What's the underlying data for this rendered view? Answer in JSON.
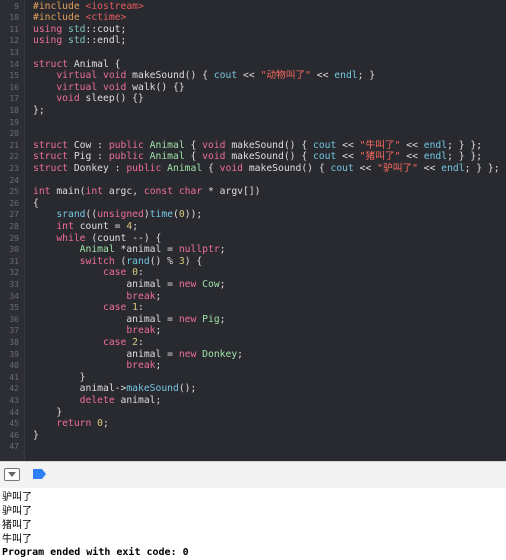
{
  "editor": {
    "lines": [
      {
        "n": "9",
        "tokens": [
          {
            "t": "#include ",
            "c": "pp"
          },
          {
            "t": "<iostream>",
            "c": "inc"
          }
        ]
      },
      {
        "n": "10",
        "tokens": [
          {
            "t": "#include ",
            "c": "pp"
          },
          {
            "t": "<ctime>",
            "c": "inc"
          }
        ]
      },
      {
        "n": "11",
        "tokens": [
          {
            "t": "using ",
            "c": "kw"
          },
          {
            "t": "std",
            "c": "ty"
          },
          {
            "t": "::cout;",
            "c": ""
          }
        ]
      },
      {
        "n": "12",
        "tokens": [
          {
            "t": "using ",
            "c": "kw"
          },
          {
            "t": "std",
            "c": "ty"
          },
          {
            "t": "::endl;",
            "c": ""
          }
        ]
      },
      {
        "n": "13",
        "tokens": []
      },
      {
        "n": "14",
        "tokens": [
          {
            "t": "struct ",
            "c": "kw"
          },
          {
            "t": "Animal {",
            "c": ""
          }
        ]
      },
      {
        "n": "15",
        "tokens": [
          {
            "t": "    ",
            "c": ""
          },
          {
            "t": "virtual void ",
            "c": "kw"
          },
          {
            "t": "makeSound() { ",
            "c": ""
          },
          {
            "t": "cout",
            "c": "fn"
          },
          {
            "t": " << ",
            "c": ""
          },
          {
            "t": "\"动物叫了\"",
            "c": "str"
          },
          {
            "t": " << ",
            "c": ""
          },
          {
            "t": "endl",
            "c": "fn"
          },
          {
            "t": "; }",
            "c": ""
          }
        ]
      },
      {
        "n": "16",
        "tokens": [
          {
            "t": "    ",
            "c": ""
          },
          {
            "t": "virtual void ",
            "c": "kw"
          },
          {
            "t": "walk() {}",
            "c": ""
          }
        ]
      },
      {
        "n": "17",
        "tokens": [
          {
            "t": "    ",
            "c": ""
          },
          {
            "t": "void ",
            "c": "kw"
          },
          {
            "t": "sleep() {}",
            "c": ""
          }
        ]
      },
      {
        "n": "18",
        "tokens": [
          {
            "t": "};",
            "c": ""
          }
        ]
      },
      {
        "n": "19",
        "tokens": []
      },
      {
        "n": "20",
        "tokens": []
      },
      {
        "n": "21",
        "tokens": [
          {
            "t": "struct ",
            "c": "kw"
          },
          {
            "t": "Cow : ",
            "c": ""
          },
          {
            "t": "public ",
            "c": "kw"
          },
          {
            "t": "Animal",
            "c": "cls"
          },
          {
            "t": " { ",
            "c": ""
          },
          {
            "t": "void ",
            "c": "kw"
          },
          {
            "t": "makeSound() { ",
            "c": ""
          },
          {
            "t": "cout",
            "c": "fn"
          },
          {
            "t": " << ",
            "c": ""
          },
          {
            "t": "\"牛叫了\"",
            "c": "str"
          },
          {
            "t": " << ",
            "c": ""
          },
          {
            "t": "endl",
            "c": "fn"
          },
          {
            "t": "; } };",
            "c": ""
          }
        ]
      },
      {
        "n": "22",
        "tokens": [
          {
            "t": "struct ",
            "c": "kw"
          },
          {
            "t": "Pig : ",
            "c": ""
          },
          {
            "t": "public ",
            "c": "kw"
          },
          {
            "t": "Animal",
            "c": "cls"
          },
          {
            "t": " { ",
            "c": ""
          },
          {
            "t": "void ",
            "c": "kw"
          },
          {
            "t": "makeSound() { ",
            "c": ""
          },
          {
            "t": "cout",
            "c": "fn"
          },
          {
            "t": " << ",
            "c": ""
          },
          {
            "t": "\"猪叫了\"",
            "c": "str"
          },
          {
            "t": " << ",
            "c": ""
          },
          {
            "t": "endl",
            "c": "fn"
          },
          {
            "t": "; } };",
            "c": ""
          }
        ]
      },
      {
        "n": "23",
        "tokens": [
          {
            "t": "struct ",
            "c": "kw"
          },
          {
            "t": "Donkey : ",
            "c": ""
          },
          {
            "t": "public ",
            "c": "kw"
          },
          {
            "t": "Animal",
            "c": "cls"
          },
          {
            "t": " { ",
            "c": ""
          },
          {
            "t": "void ",
            "c": "kw"
          },
          {
            "t": "makeSound() { ",
            "c": ""
          },
          {
            "t": "cout",
            "c": "fn"
          },
          {
            "t": " << ",
            "c": ""
          },
          {
            "t": "\"驴叫了\"",
            "c": "str"
          },
          {
            "t": " << ",
            "c": ""
          },
          {
            "t": "endl",
            "c": "fn"
          },
          {
            "t": "; } };",
            "c": ""
          }
        ]
      },
      {
        "n": "24",
        "tokens": []
      },
      {
        "n": "25",
        "tokens": [
          {
            "t": "int ",
            "c": "kw"
          },
          {
            "t": "main(",
            "c": ""
          },
          {
            "t": "int ",
            "c": "kw"
          },
          {
            "t": "argc, ",
            "c": ""
          },
          {
            "t": "const char ",
            "c": "kw"
          },
          {
            "t": "* argv[])",
            "c": ""
          }
        ]
      },
      {
        "n": "26",
        "tokens": [
          {
            "t": "{",
            "c": ""
          }
        ]
      },
      {
        "n": "27",
        "tokens": [
          {
            "t": "    ",
            "c": ""
          },
          {
            "t": "srand",
            "c": "fn"
          },
          {
            "t": "((",
            "c": ""
          },
          {
            "t": "unsigned",
            "c": "kw"
          },
          {
            "t": ")",
            "c": ""
          },
          {
            "t": "time",
            "c": "fn"
          },
          {
            "t": "(",
            "c": ""
          },
          {
            "t": "0",
            "c": "num"
          },
          {
            "t": "));",
            "c": ""
          }
        ]
      },
      {
        "n": "28",
        "tokens": [
          {
            "t": "    ",
            "c": ""
          },
          {
            "t": "int ",
            "c": "kw"
          },
          {
            "t": "count = ",
            "c": ""
          },
          {
            "t": "4",
            "c": "num"
          },
          {
            "t": ";",
            "c": ""
          }
        ]
      },
      {
        "n": "29",
        "tokens": [
          {
            "t": "    ",
            "c": ""
          },
          {
            "t": "while ",
            "c": "kw"
          },
          {
            "t": "(count --) {",
            "c": ""
          }
        ]
      },
      {
        "n": "30",
        "tokens": [
          {
            "t": "        ",
            "c": ""
          },
          {
            "t": "Animal",
            "c": "cls"
          },
          {
            "t": " *animal = ",
            "c": ""
          },
          {
            "t": "nullptr",
            "c": "kw"
          },
          {
            "t": ";",
            "c": ""
          }
        ]
      },
      {
        "n": "31",
        "tokens": [
          {
            "t": "        ",
            "c": ""
          },
          {
            "t": "switch ",
            "c": "kw"
          },
          {
            "t": "(",
            "c": ""
          },
          {
            "t": "rand",
            "c": "fn"
          },
          {
            "t": "() % ",
            "c": ""
          },
          {
            "t": "3",
            "c": "num"
          },
          {
            "t": ") {",
            "c": ""
          }
        ]
      },
      {
        "n": "32",
        "tokens": [
          {
            "t": "            ",
            "c": ""
          },
          {
            "t": "case ",
            "c": "kw"
          },
          {
            "t": "0",
            "c": "num"
          },
          {
            "t": ":",
            "c": ""
          }
        ]
      },
      {
        "n": "33",
        "tokens": [
          {
            "t": "                ",
            "c": ""
          },
          {
            "t": "animal = ",
            "c": ""
          },
          {
            "t": "new ",
            "c": "kw"
          },
          {
            "t": "Cow",
            "c": "cls"
          },
          {
            "t": ";",
            "c": ""
          }
        ]
      },
      {
        "n": "34",
        "tokens": [
          {
            "t": "                ",
            "c": ""
          },
          {
            "t": "break",
            "c": "kw"
          },
          {
            "t": ";",
            "c": ""
          }
        ]
      },
      {
        "n": "35",
        "tokens": [
          {
            "t": "            ",
            "c": ""
          },
          {
            "t": "case ",
            "c": "kw"
          },
          {
            "t": "1",
            "c": "num"
          },
          {
            "t": ":",
            "c": ""
          }
        ]
      },
      {
        "n": "36",
        "tokens": [
          {
            "t": "                ",
            "c": ""
          },
          {
            "t": "animal = ",
            "c": ""
          },
          {
            "t": "new ",
            "c": "kw"
          },
          {
            "t": "Pig",
            "c": "cls"
          },
          {
            "t": ";",
            "c": ""
          }
        ]
      },
      {
        "n": "37",
        "tokens": [
          {
            "t": "                ",
            "c": ""
          },
          {
            "t": "break",
            "c": "kw"
          },
          {
            "t": ";",
            "c": ""
          }
        ]
      },
      {
        "n": "38",
        "tokens": [
          {
            "t": "            ",
            "c": ""
          },
          {
            "t": "case ",
            "c": "kw"
          },
          {
            "t": "2",
            "c": "num"
          },
          {
            "t": ":",
            "c": ""
          }
        ]
      },
      {
        "n": "39",
        "tokens": [
          {
            "t": "                ",
            "c": ""
          },
          {
            "t": "animal = ",
            "c": ""
          },
          {
            "t": "new ",
            "c": "kw"
          },
          {
            "t": "Donkey",
            "c": "cls"
          },
          {
            "t": ";",
            "c": ""
          }
        ]
      },
      {
        "n": "40",
        "tokens": [
          {
            "t": "                ",
            "c": ""
          },
          {
            "t": "break",
            "c": "kw"
          },
          {
            "t": ";",
            "c": ""
          }
        ]
      },
      {
        "n": "41",
        "tokens": [
          {
            "t": "        }",
            "c": ""
          }
        ]
      },
      {
        "n": "42",
        "tokens": [
          {
            "t": "        animal->",
            "c": ""
          },
          {
            "t": "makeSound",
            "c": "fn"
          },
          {
            "t": "();",
            "c": ""
          }
        ]
      },
      {
        "n": "43",
        "tokens": [
          {
            "t": "        ",
            "c": ""
          },
          {
            "t": "delete ",
            "c": "kw"
          },
          {
            "t": "animal;",
            "c": ""
          }
        ]
      },
      {
        "n": "44",
        "tokens": [
          {
            "t": "    }",
            "c": ""
          }
        ]
      },
      {
        "n": "45",
        "tokens": [
          {
            "t": "    ",
            "c": ""
          },
          {
            "t": "return ",
            "c": "kw"
          },
          {
            "t": "0",
            "c": "num"
          },
          {
            "t": ";",
            "c": ""
          }
        ]
      },
      {
        "n": "46",
        "tokens": [
          {
            "t": "}",
            "c": ""
          }
        ]
      },
      {
        "n": "47",
        "tokens": []
      }
    ]
  },
  "debug_bar": {
    "toggle_icon": "hide-debug-area-icon",
    "breakpoint_icon": "breakpoint-toggle-icon",
    "breakpoint_color": "#2f7ff6"
  },
  "console": {
    "lines": [
      {
        "text": "驴叫了",
        "bold": false
      },
      {
        "text": "驴叫了",
        "bold": false
      },
      {
        "text": "猪叫了",
        "bold": false
      },
      {
        "text": "牛叫了",
        "bold": false
      },
      {
        "text": "Program ended with exit code: 0",
        "bold": true
      }
    ]
  }
}
